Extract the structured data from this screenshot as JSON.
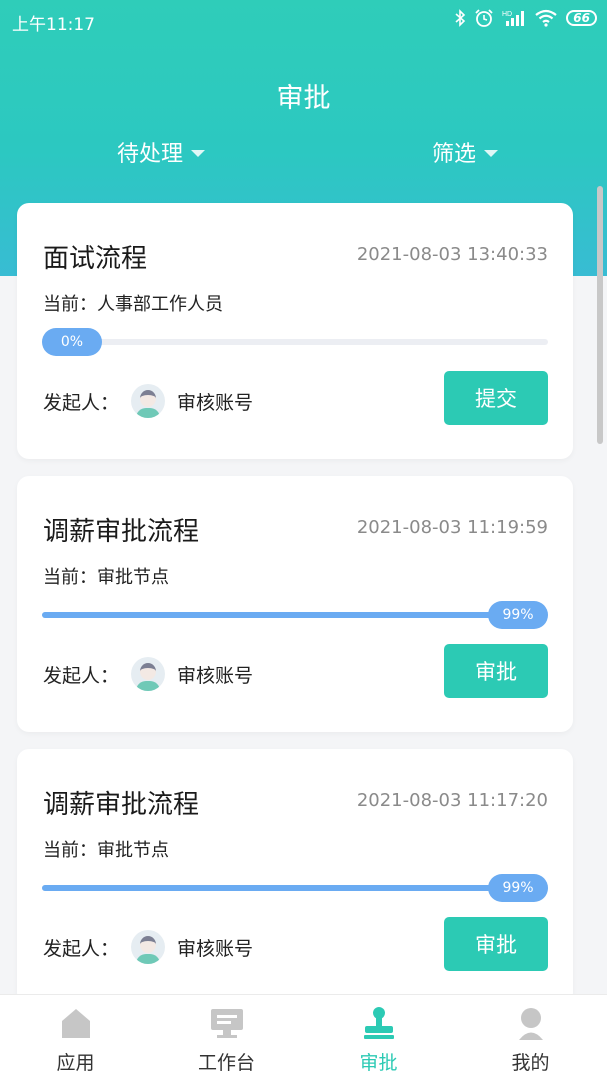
{
  "status_bar": {
    "time": "上午11:17",
    "battery": "66"
  },
  "header": {
    "title": "审批",
    "filter_pending": "待处理",
    "filter_screen": "筛选"
  },
  "cards": [
    {
      "title": "面试流程",
      "time": "2021-08-03 13:40:33",
      "current_label": "当前：",
      "current": "人事部工作人员",
      "progress": 0,
      "progress_text": "0%",
      "initiator_label": "发起人：",
      "initiator": "审核账号",
      "action": "提交"
    },
    {
      "title": "调薪审批流程",
      "time": "2021-08-03 11:19:59",
      "current_label": "当前：",
      "current": "审批节点",
      "progress": 99,
      "progress_text": "99%",
      "initiator_label": "发起人：",
      "initiator": "审核账号",
      "action": "审批"
    },
    {
      "title": "调薪审批流程",
      "time": "2021-08-03 11:17:20",
      "current_label": "当前：",
      "current": "审批节点",
      "progress": 99,
      "progress_text": "99%",
      "initiator_label": "发起人：",
      "initiator": "审核账号",
      "action": "审批"
    }
  ],
  "bottom_nav": [
    {
      "label": "应用",
      "icon": "home-icon"
    },
    {
      "label": "工作台",
      "icon": "monitor-icon"
    },
    {
      "label": "审批",
      "icon": "stamp-icon",
      "active": true
    },
    {
      "label": "我的",
      "icon": "user-icon"
    }
  ],
  "colors": {
    "accent": "#2ccab4",
    "progress": "#6aabf2",
    "nav_inactive": "#c6c6c6"
  }
}
